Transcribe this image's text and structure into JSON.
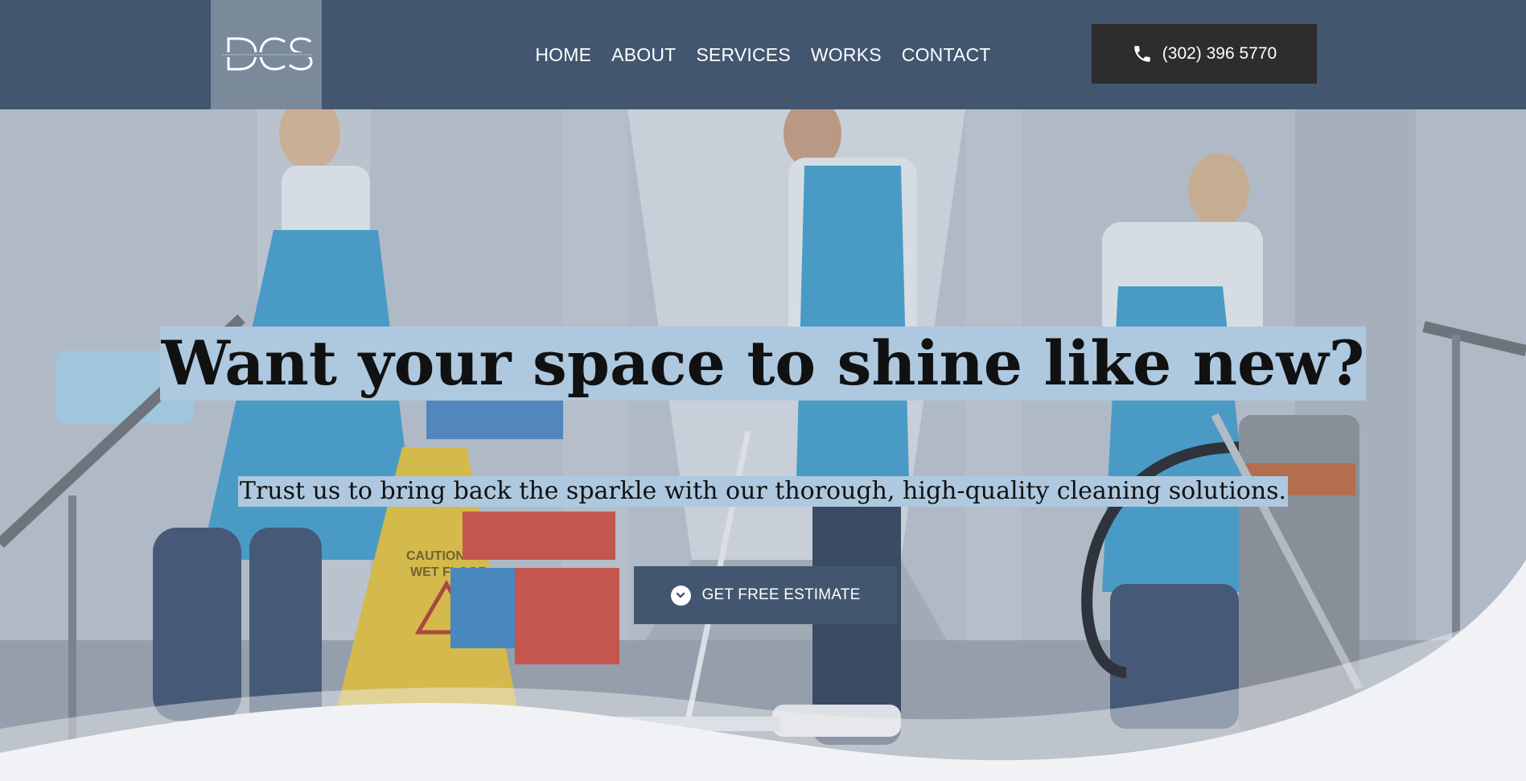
{
  "header": {
    "logo_icon": "dcs-logo-icon",
    "nav": [
      {
        "label": "HOME"
      },
      {
        "label": "ABOUT"
      },
      {
        "label": "SERVICES"
      },
      {
        "label": "WORKS"
      },
      {
        "label": "CONTACT"
      }
    ],
    "phone": {
      "icon": "phone-icon",
      "number": "(302) 396 5770"
    }
  },
  "hero": {
    "title": "Want your space to shine like new?",
    "subtitle": "Trust us to bring back the sparkle with our thorough, high-quality cleaning solutions.",
    "cta": {
      "icon": "chevron-down-circle-icon",
      "label": "GET FREE ESTIMATE"
    }
  },
  "colors": {
    "header_bg": "#42566f",
    "logo_bg": "#7a8a9b",
    "phone_button_bg": "#2d2d2d",
    "highlight": "#aec9df",
    "cta_bg": "#42566f",
    "wave": "#f1f2f5"
  }
}
